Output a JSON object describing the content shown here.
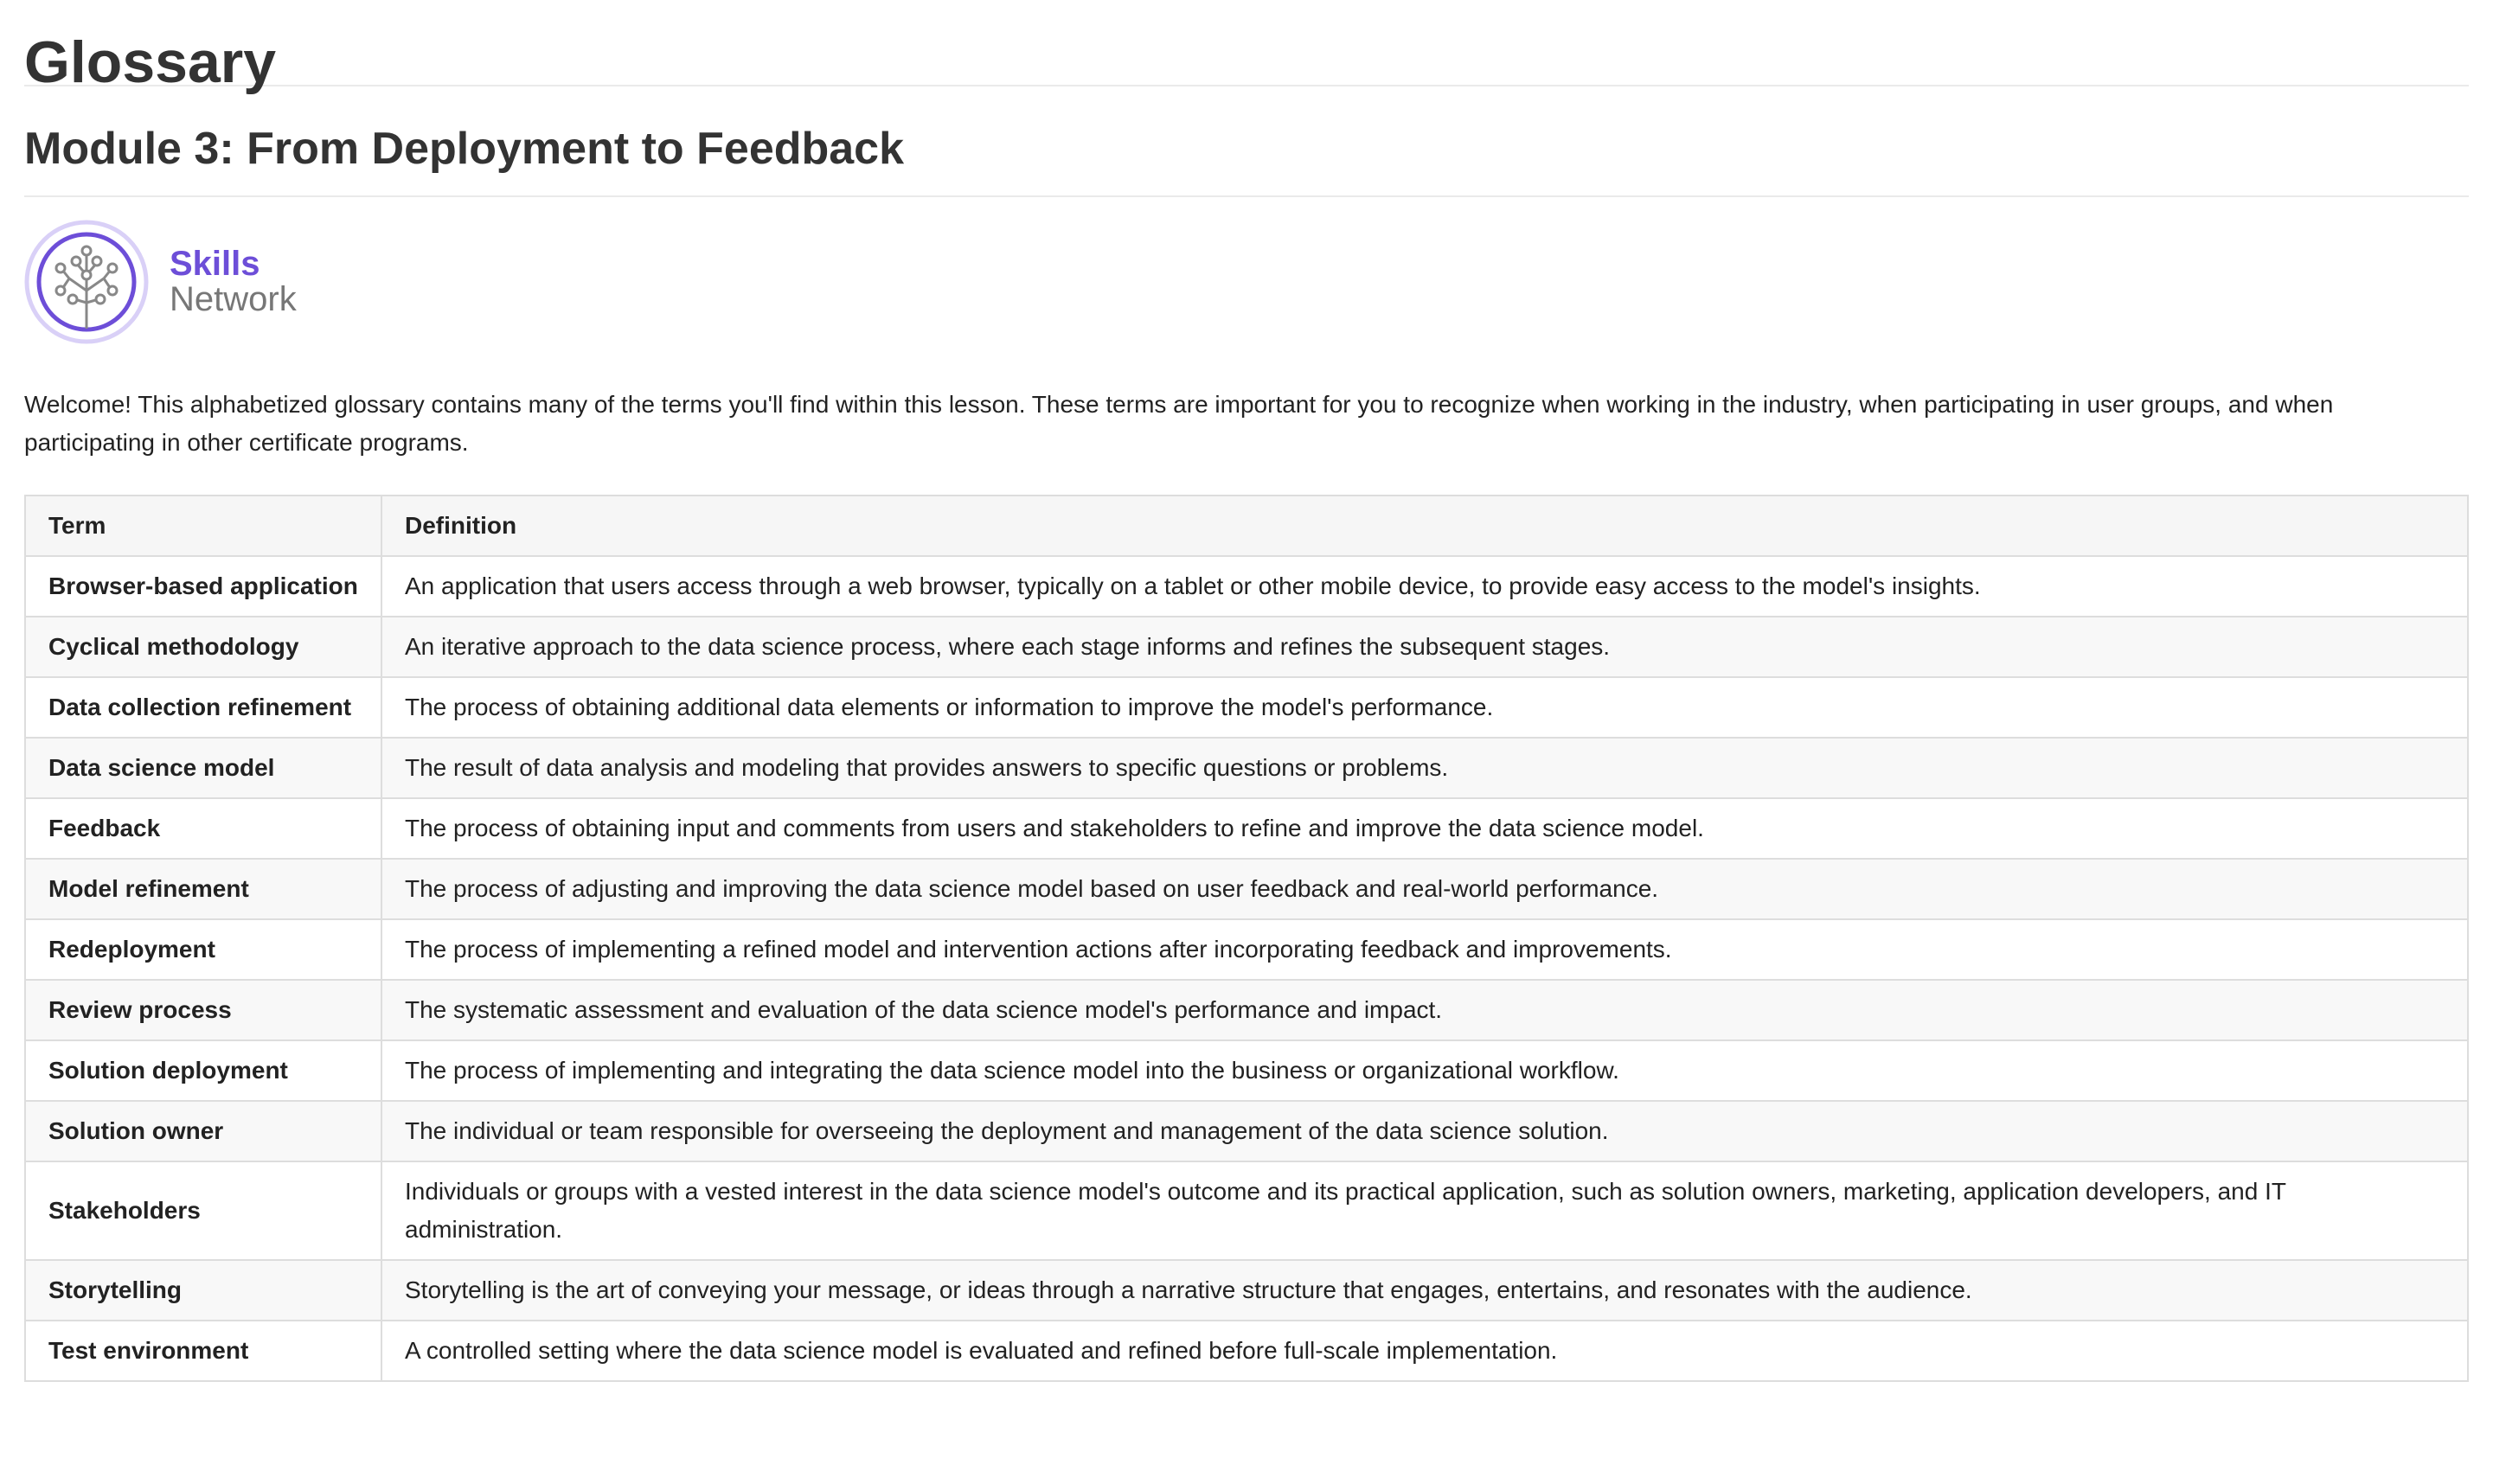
{
  "page": {
    "title": "Glossary",
    "module_title": "Module 3: From Deployment to Feedback",
    "intro": "Welcome! This alphabetized glossary contains many of the terms you'll find within this lesson. These terms are important for you to recognize when working in the industry, when participating in user groups, and when participating in other certificate programs."
  },
  "logo": {
    "line1": "Skills",
    "line2": "Network",
    "accent": "#6d4ed8"
  },
  "table": {
    "headers": [
      "Term",
      "Definition"
    ],
    "rows": [
      {
        "term": "Browser-based application",
        "definition": "An application that users access through a web browser, typically on a tablet or other mobile device, to provide easy access to the model's insights."
      },
      {
        "term": "Cyclical methodology",
        "definition": "An iterative approach to the data science process, where each stage informs and refines the subsequent stages."
      },
      {
        "term": "Data collection refinement",
        "definition": "The process of obtaining additional data elements or information to improve the model's performance."
      },
      {
        "term": "Data science model",
        "definition": "The result of data analysis and modeling that provides answers to specific questions or problems."
      },
      {
        "term": "Feedback",
        "definition": "The process of obtaining input and comments from users and stakeholders to refine and improve the data science model."
      },
      {
        "term": "Model refinement",
        "definition": "The process of adjusting and improving the data science model based on user feedback and real-world performance."
      },
      {
        "term": "Redeployment",
        "definition": "The process of implementing a refined model and intervention actions after incorporating feedback and improvements."
      },
      {
        "term": "Review process",
        "definition": "The systematic assessment and evaluation of the data science model's performance and impact."
      },
      {
        "term": "Solution deployment",
        "definition": "The process of implementing and integrating the data science model into the business or organizational workflow."
      },
      {
        "term": "Solution owner",
        "definition": "The individual or team responsible for overseeing the deployment and management of the data science solution."
      },
      {
        "term": "Stakeholders",
        "definition": "Individuals or groups with a vested interest in the data science model's outcome and its practical application, such as solution owners, marketing, application developers, and IT administration."
      },
      {
        "term": "Storytelling",
        "definition": "Storytelling is the art of conveying your message, or ideas through a narrative structure that engages, entertains, and resonates with the audience."
      },
      {
        "term": "Test environment",
        "definition": "A controlled setting where the data science model is evaluated and refined before full-scale implementation."
      }
    ]
  }
}
